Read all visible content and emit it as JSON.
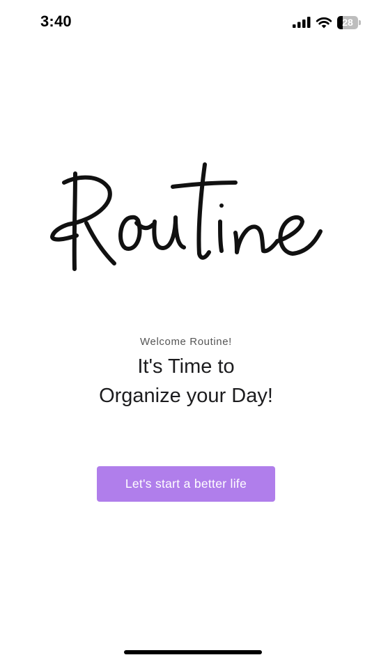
{
  "status_bar": {
    "time": "3:40",
    "battery_level": "28",
    "battery_fraction": 0.28,
    "icons": [
      "signal-icon",
      "wifi-icon",
      "battery-icon"
    ]
  },
  "logo": {
    "text": "Routine"
  },
  "welcome": {
    "subtitle": "Welcome Routine!",
    "headline_line1": "It's Time to",
    "headline_line2": "Organize your Day!"
  },
  "cta": {
    "label": "Let's start a better life"
  },
  "colors": {
    "accent": "#b07eeb",
    "background": "#ffffff",
    "text": "#1c1c1e",
    "subtitle": "#555555"
  }
}
